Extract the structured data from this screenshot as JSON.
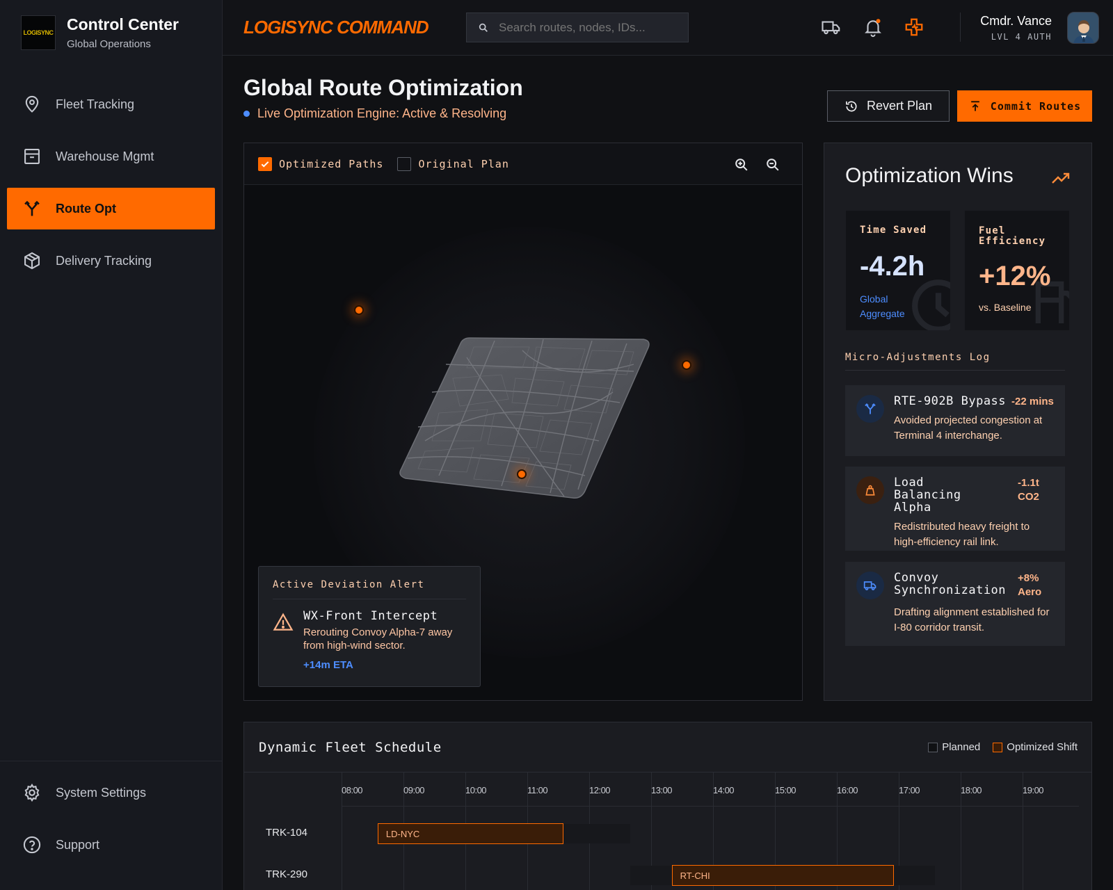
{
  "sidebar": {
    "logo_text": "LOGISYNC",
    "title": "Control Center",
    "subtitle": "Global Operations",
    "items": [
      {
        "label": "Fleet Tracking",
        "icon": "map-pin-icon"
      },
      {
        "label": "Warehouse Mgmt",
        "icon": "archive-box-icon"
      },
      {
        "label": "Route Opt",
        "icon": "route-split-icon",
        "active": true
      },
      {
        "label": "Delivery Tracking",
        "icon": "package-icon"
      }
    ],
    "bottom_items": [
      {
        "label": "System Settings",
        "icon": "gear-icon"
      },
      {
        "label": "Support",
        "icon": "help-circle-icon"
      }
    ]
  },
  "header": {
    "app_title": "LOGISYNC COMMAND",
    "search_placeholder": "Search routes, nodes, IDs...",
    "icons": [
      "truck-icon",
      "bell-icon",
      "medical-cross-icon"
    ],
    "user_name": "Cmdr. Vance",
    "user_role": "LVL 4 AUTH"
  },
  "page": {
    "title": "Global Route Optimization",
    "status": "Live Optimization Engine: Active & Resolving",
    "revert_label": "Revert Plan",
    "commit_label": "Commit Routes"
  },
  "map": {
    "toggle_optimized": "Optimized Paths",
    "toggle_optimized_checked": true,
    "toggle_original": "Original Plan",
    "toggle_original_checked": false,
    "alert": {
      "heading": "Active Deviation Alert",
      "title": "WX-Front Intercept",
      "description": "Rerouting Convoy Alpha-7 away from high-wind sector.",
      "eta": "+14m ETA"
    }
  },
  "wins": {
    "title": "Optimization Wins",
    "stats": [
      {
        "label": "Time Saved",
        "value": "-4.2h",
        "note": "Global Aggregate"
      },
      {
        "label": "Fuel Efficiency",
        "value": "+12%",
        "note": "vs. Baseline"
      }
    ],
    "log_title": "Micro-Adjustments Log",
    "log": [
      {
        "name": "RTE-902B Bypass",
        "delta": "-22 mins",
        "description": "Avoided projected congestion at Terminal 4 interchange.",
        "icon": "route-split-icon"
      },
      {
        "name": "Load Balancing Alpha",
        "delta": "-1.1t CO2",
        "description": "Redistributed heavy freight to high-efficiency rail link.",
        "icon": "weight-icon"
      },
      {
        "name": "Convoy Synchronization",
        "delta": "+8% Aero",
        "description": "Drafting alignment established for I-80 corridor transit.",
        "icon": "truck-icon"
      }
    ]
  },
  "schedule": {
    "title": "Dynamic Fleet Schedule",
    "legend_planned": "Planned",
    "legend_optimized": "Optimized Shift",
    "hours": [
      "08:00",
      "09:00",
      "10:00",
      "11:00",
      "12:00",
      "13:00",
      "14:00",
      "15:00",
      "16:00",
      "17:00",
      "18:00",
      "19:00"
    ],
    "trucks": [
      {
        "id": "TRK-104",
        "planned_start": "08:35",
        "planned_end": "12:40",
        "optimized_start": "08:35",
        "optimized_end": "11:35",
        "route": "LD-NYC"
      },
      {
        "id": "TRK-290",
        "planned_start": "12:40",
        "planned_end": "17:35",
        "optimized_start": "13:20",
        "optimized_end": "16:55",
        "route": "RT-CHI"
      }
    ]
  },
  "colors": {
    "accent": "#ff6a00",
    "info": "#4d8dff",
    "background": "#101114",
    "panel": "#1b1c21"
  }
}
